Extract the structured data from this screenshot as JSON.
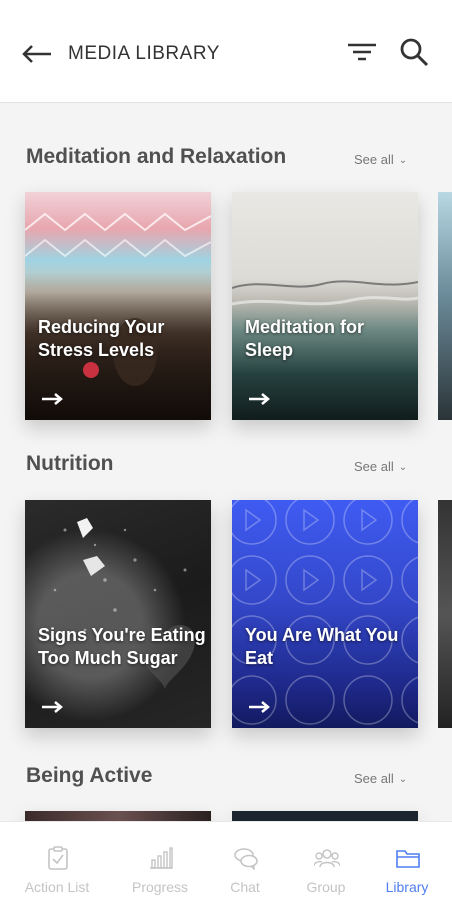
{
  "header": {
    "title": "MEDIA LIBRARY",
    "back_icon": "arrow-left-icon",
    "filter_icon": "filter-icon",
    "search_icon": "search-icon"
  },
  "sections": [
    {
      "title": "Meditation and Relaxation",
      "see_all": "See all",
      "cards": [
        {
          "title": "Reducing Your Stress Levels"
        },
        {
          "title": "Meditation for Sleep"
        }
      ]
    },
    {
      "title": "Nutrition",
      "see_all": "See all",
      "cards": [
        {
          "title": "Signs You're Eating Too Much Sugar"
        },
        {
          "title": "You Are What You Eat"
        }
      ]
    },
    {
      "title": "Being Active",
      "see_all": "See all",
      "cards": []
    }
  ],
  "nav": {
    "items": [
      {
        "label": "Action List",
        "icon": "clipboard-check-icon"
      },
      {
        "label": "Progress",
        "icon": "bar-chart-icon"
      },
      {
        "label": "Chat",
        "icon": "chat-bubbles-icon"
      },
      {
        "label": "Group",
        "icon": "group-icon"
      },
      {
        "label": "Library",
        "icon": "folder-icon"
      }
    ],
    "active": "Library"
  },
  "colors": {
    "accent": "#4f7ef0",
    "inactive": "#c4c4c4",
    "background": "#f4f4f4"
  }
}
